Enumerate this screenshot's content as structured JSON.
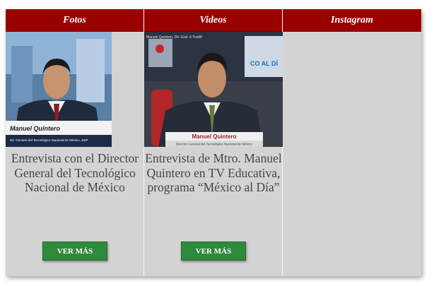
{
  "columns": [
    {
      "header": "Fotos",
      "image": {
        "lower_third_name": "Manuel Quintero",
        "lower_third_title": "Dir. General del Tecnológico Nacional de México, SEP"
      },
      "caption": "Entrevista con el Director General del Tecnológico Nacional de México",
      "button_label": "VER MÁS"
    },
    {
      "header": "Videos",
      "image": {
        "top_text": "Manuel Quintero, Dir. Gral. d Tnoldl",
        "lower_third_name": "Manuel Quintero",
        "lower_third_title": "Director General del Tecnológico Nacional de México",
        "screen_text": "CO AL DÍ"
      },
      "caption": "Entrevista de Mtro. Manuel Quintero en TV Educativa, programa “México al Día”",
      "button_label": "VER MÁS"
    },
    {
      "header": "Instagram"
    }
  ],
  "colors": {
    "header_bg": "#9b0000",
    "panel_bg": "#d3d3d3",
    "button_bg": "#2e8b3c"
  }
}
